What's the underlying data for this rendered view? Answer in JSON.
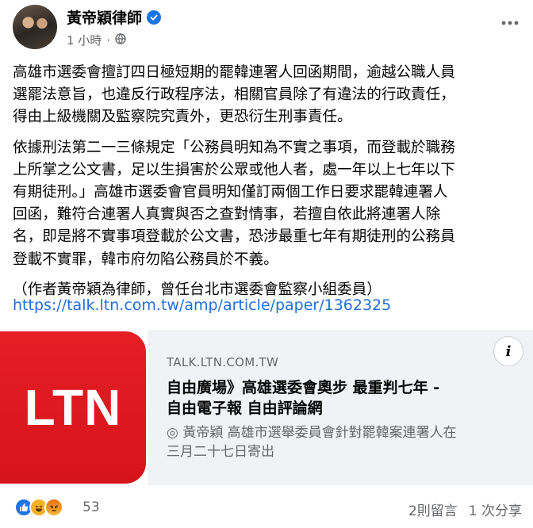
{
  "post": {
    "author": "黃帝穎律師",
    "time": "1 小時",
    "separator": "·",
    "paragraphs": [
      "高雄市選委會擅訂四日極短期的罷韓連署人回函期間，逾越公職人員\n選罷法意旨，也違反行政程序法，相關官員除了有違法的行政責任，\n得由上級機關及監察院究責外，更恐衍生刑事責任。",
      "依據刑法第二一三條規定「公務員明知為不實之事項，而登載於職務\n上所掌之公文書，足以生損害於公眾或他人者，處一年以上七年以下\n有期徒刑。」高雄市選委會官員明知僅訂兩個工作日要求罷韓連署人\n回函，難符合連署人真實與否之查對情事，若擅自依此將連署人除\n名，即是將不實事項登載於公文書，恐涉最重七年有期徒刑的公務員\n登載不實罪，韓市府勿陷公務員於不義。",
      "（作者黃帝穎為律師，曾任台北市選委會監察小組委員）"
    ],
    "link": "https://talk.ltn.com.tw/amp/article/paper/1362325"
  },
  "card": {
    "logo_text": "LTN",
    "domain": "TALK.LTN.COM.TW",
    "title": "自由廣場》高雄選委會奧步 最重判七年 -\n自由電子報 自由評論網",
    "description": "◎ 黃帝穎 高雄市選舉委員會針對罷韓案連署人在\n三月二十七日寄出",
    "info_glyph": "i"
  },
  "footer": {
    "reaction_count": "53",
    "comments": "2則留言",
    "shares": "1 次分享"
  },
  "icons": {
    "verified": "verified-badge-icon",
    "privacy": "globe-icon",
    "more": "more-horizontal-icon",
    "reactions": [
      "like-reaction-icon",
      "haha-reaction-icon",
      "angry-reaction-icon"
    ]
  },
  "colors": {
    "link": "#216fdb",
    "verified": "#1b74e4",
    "ltn_red": "#e61e25",
    "card_bg": "#f0f2f5",
    "muted": "#65676b"
  }
}
